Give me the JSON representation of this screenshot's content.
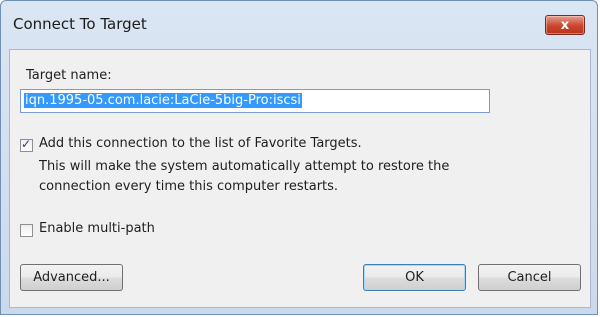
{
  "window": {
    "title": "Connect To Target",
    "close_symbol": "x"
  },
  "form": {
    "target_name_label": "Target name:",
    "target_name_value": "iqn.1995-05.com.lacie:LaCie-5big-Pro:iscsi",
    "favorites": {
      "checked": true,
      "label": "Add this connection to the list of Favorite Targets.",
      "description": "This will make the system automatically attempt to restore the connection every time this computer restarts."
    },
    "multipath": {
      "checked": false,
      "label": "Enable multi-path"
    }
  },
  "buttons": {
    "advanced": "Advanced...",
    "ok": "OK",
    "cancel": "Cancel"
  },
  "colors": {
    "selection": "#3399ff",
    "close_button": "#c9462f"
  }
}
